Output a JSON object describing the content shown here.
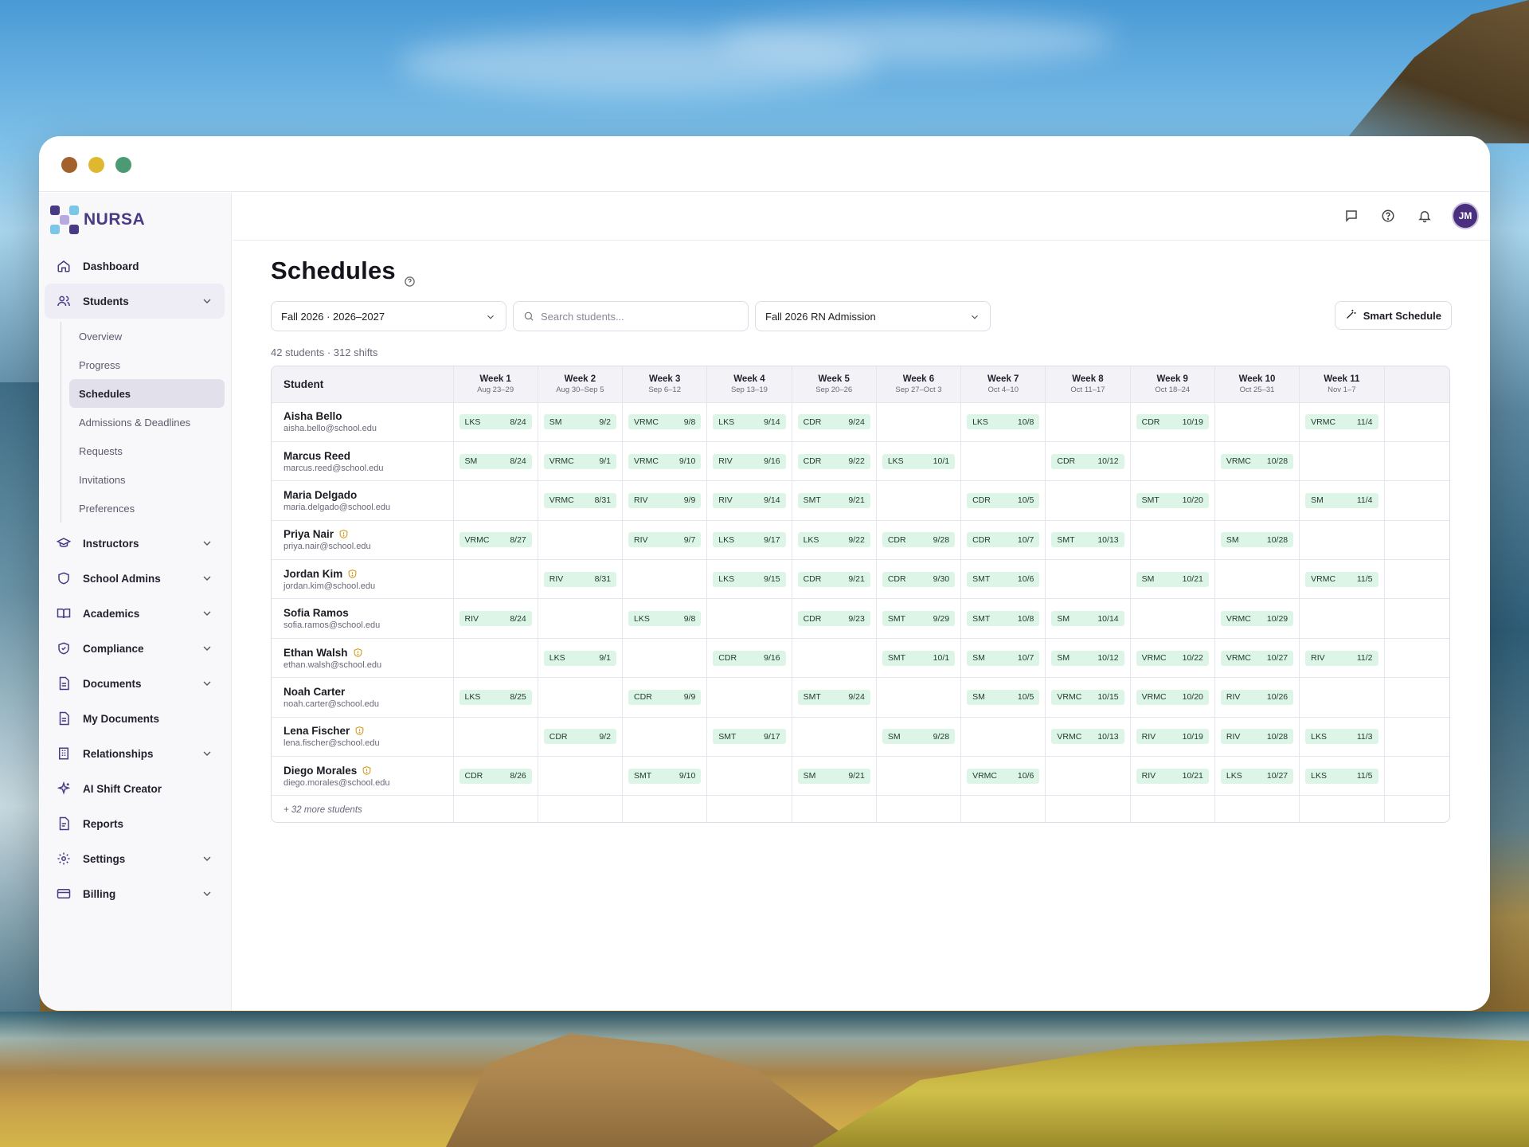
{
  "brand": {
    "name": "NURSA"
  },
  "nav": {
    "dashboard": "Dashboard",
    "students": "Students",
    "students_sub": [
      "Overview",
      "Progress",
      "Schedules",
      "Admissions & Deadlines",
      "Requests",
      "Invitations",
      "Preferences"
    ],
    "instructors": "Instructors",
    "school_admins": "School Admins",
    "academics": "Academics",
    "compliance": "Compliance",
    "documents": "Documents",
    "my_documents": "My Documents",
    "relationships": "Relationships",
    "ai_shift_creator": "AI Shift Creator",
    "reports": "Reports",
    "settings": "Settings",
    "billing": "Billing"
  },
  "topbar": {
    "avatar_initials": "JM"
  },
  "page": {
    "title": "Schedules",
    "term_select": "Fall 2026 · 2026–2027",
    "search_placeholder": "Search students...",
    "cohort_select": "Fall 2026 RN Admission",
    "smart_schedule": "Smart Schedule",
    "counts": "42 students · 312 shifts"
  },
  "table": {
    "student_header": "Student",
    "weeks": [
      {
        "label": "Week 1",
        "range": "Aug 23–29"
      },
      {
        "label": "Week 2",
        "range": "Aug 30–Sep 5"
      },
      {
        "label": "Week 3",
        "range": "Sep 6–12"
      },
      {
        "label": "Week 4",
        "range": "Sep 13–19"
      },
      {
        "label": "Week 5",
        "range": "Sep 20–26"
      },
      {
        "label": "Week 6",
        "range": "Sep 27–Oct 3"
      },
      {
        "label": "Week 7",
        "range": "Oct 4–10"
      },
      {
        "label": "Week 8",
        "range": "Oct 11–17"
      },
      {
        "label": "Week 9",
        "range": "Oct 18–24"
      },
      {
        "label": "Week 10",
        "range": "Oct 25–31"
      },
      {
        "label": "Week 11",
        "range": "Nov 1–7"
      }
    ],
    "rows": [
      {
        "name": "Aisha Bello",
        "email": "aisha.bello@school.edu",
        "flag": false,
        "shifts": [
          [
            "LKS",
            "8/24"
          ],
          [
            "SM",
            "9/2"
          ],
          [
            "VRMC",
            "9/8"
          ],
          [
            "LKS",
            "9/14"
          ],
          [
            "CDR",
            "9/24"
          ],
          null,
          [
            "LKS",
            "10/8"
          ],
          null,
          [
            "CDR",
            "10/19"
          ],
          null,
          [
            "VRMC",
            "11/4"
          ]
        ]
      },
      {
        "name": "Marcus Reed",
        "email": "marcus.reed@school.edu",
        "flag": false,
        "shifts": [
          [
            "SM",
            "8/24"
          ],
          [
            "VRMC",
            "9/1"
          ],
          [
            "VRMC",
            "9/10"
          ],
          [
            "RIV",
            "9/16"
          ],
          [
            "CDR",
            "9/22"
          ],
          [
            "LKS",
            "10/1"
          ],
          null,
          [
            "CDR",
            "10/12"
          ],
          null,
          [
            "VRMC",
            "10/28"
          ],
          null
        ]
      },
      {
        "name": "Maria Delgado",
        "email": "maria.delgado@school.edu",
        "flag": false,
        "shifts": [
          null,
          [
            "VRMC",
            "8/31"
          ],
          [
            "RIV",
            "9/9"
          ],
          [
            "RIV",
            "9/14"
          ],
          [
            "SMT",
            "9/21"
          ],
          null,
          [
            "CDR",
            "10/5"
          ],
          null,
          [
            "SMT",
            "10/20"
          ],
          null,
          [
            "SM",
            "11/4"
          ]
        ]
      },
      {
        "name": "Priya Nair",
        "email": "priya.nair@school.edu",
        "flag": true,
        "shifts": [
          [
            "VRMC",
            "8/27"
          ],
          null,
          [
            "RIV",
            "9/7"
          ],
          [
            "LKS",
            "9/17"
          ],
          [
            "LKS",
            "9/22"
          ],
          [
            "CDR",
            "9/28"
          ],
          [
            "CDR",
            "10/7"
          ],
          [
            "SMT",
            "10/13"
          ],
          null,
          [
            "SM",
            "10/28"
          ],
          null
        ]
      },
      {
        "name": "Jordan Kim",
        "email": "jordan.kim@school.edu",
        "flag": true,
        "shifts": [
          null,
          [
            "RIV",
            "8/31"
          ],
          null,
          [
            "LKS",
            "9/15"
          ],
          [
            "CDR",
            "9/21"
          ],
          [
            "CDR",
            "9/30"
          ],
          [
            "SMT",
            "10/6"
          ],
          null,
          [
            "SM",
            "10/21"
          ],
          null,
          [
            "VRMC",
            "11/5"
          ]
        ]
      },
      {
        "name": "Sofia Ramos",
        "email": "sofia.ramos@school.edu",
        "flag": false,
        "shifts": [
          [
            "RIV",
            "8/24"
          ],
          null,
          [
            "LKS",
            "9/8"
          ],
          null,
          [
            "CDR",
            "9/23"
          ],
          [
            "SMT",
            "9/29"
          ],
          [
            "SMT",
            "10/8"
          ],
          [
            "SM",
            "10/14"
          ],
          null,
          [
            "VRMC",
            "10/29"
          ],
          null
        ]
      },
      {
        "name": "Ethan Walsh",
        "email": "ethan.walsh@school.edu",
        "flag": true,
        "shifts": [
          null,
          [
            "LKS",
            "9/1"
          ],
          null,
          [
            "CDR",
            "9/16"
          ],
          null,
          [
            "SMT",
            "10/1"
          ],
          [
            "SM",
            "10/7"
          ],
          [
            "SM",
            "10/12"
          ],
          [
            "VRMC",
            "10/22"
          ],
          [
            "VRMC",
            "10/27"
          ],
          [
            "RIV",
            "11/2"
          ]
        ]
      },
      {
        "name": "Noah Carter",
        "email": "noah.carter@school.edu",
        "flag": false,
        "shifts": [
          [
            "LKS",
            "8/25"
          ],
          null,
          [
            "CDR",
            "9/9"
          ],
          null,
          [
            "SMT",
            "9/24"
          ],
          null,
          [
            "SM",
            "10/5"
          ],
          [
            "VRMC",
            "10/15"
          ],
          [
            "VRMC",
            "10/20"
          ],
          [
            "RIV",
            "10/26"
          ],
          null
        ]
      },
      {
        "name": "Lena Fischer",
        "email": "lena.fischer@school.edu",
        "flag": true,
        "shifts": [
          null,
          [
            "CDR",
            "9/2"
          ],
          null,
          [
            "SMT",
            "9/17"
          ],
          null,
          [
            "SM",
            "9/28"
          ],
          null,
          [
            "VRMC",
            "10/13"
          ],
          [
            "RIV",
            "10/19"
          ],
          [
            "RIV",
            "10/28"
          ],
          [
            "LKS",
            "11/3"
          ]
        ]
      },
      {
        "name": "Diego Morales",
        "email": "diego.morales@school.edu",
        "flag": true,
        "shifts": [
          [
            "CDR",
            "8/26"
          ],
          null,
          [
            "SMT",
            "9/10"
          ],
          null,
          [
            "SM",
            "9/21"
          ],
          null,
          [
            "VRMC",
            "10/6"
          ],
          null,
          [
            "RIV",
            "10/21"
          ],
          [
            "LKS",
            "10/27"
          ],
          [
            "LKS",
            "11/5"
          ]
        ]
      }
    ],
    "more_students": "+ 32 more students"
  },
  "colors": {
    "brand": "#4a3a86",
    "chip_bg": "#dcf5e7",
    "avatar": "#4a2f7e"
  }
}
